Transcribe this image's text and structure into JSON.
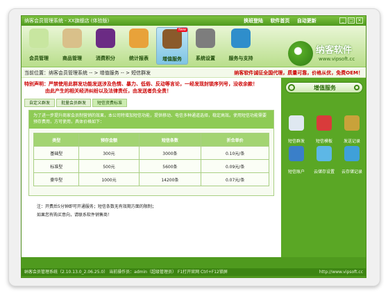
{
  "window": {
    "title": "纳客会员管理系统 - XX旗舰店 (体验版)",
    "links": [
      "换班登陆",
      "软件首页",
      "自动更新"
    ],
    "controls": [
      "_",
      "□",
      "✕"
    ]
  },
  "toolbar": {
    "items": [
      {
        "label": "会员管理",
        "color": "#c8e6a0"
      },
      {
        "label": "商品管理",
        "color": "#d9c08a"
      },
      {
        "label": "消费积分",
        "color": "#6b2b84"
      },
      {
        "label": "统计报表",
        "color": "#e8a23a"
      },
      {
        "label": "增值服务",
        "color": "#8a5a2b",
        "badge": "New"
      },
      {
        "label": "系统设置",
        "color": "#7d7d7d"
      },
      {
        "label": "服务与支持",
        "color": "#2f8ecb"
      }
    ]
  },
  "logo": {
    "name": "纳客软件",
    "url": "www.vipsoft.cc"
  },
  "location": {
    "text": "当前位置：纳客会员管理系统 -- > 增值服务 -- > 短信群发",
    "notice": "纳客软件诚征全国代理，质量可靠，价格从优，免费OEM！"
  },
  "notice": {
    "line1": "特别声明：严禁使用此群发功能发送涉及色情、暴力、低俗、反动等言论，一经发现封锁序列号，没收余款！",
    "line2": "由此产生的相关经济纠纷以及法律责任，由发送者负全责！"
  },
  "subtabs": [
    "自定义群发",
    "批量会员群发",
    "短信资费标准"
  ],
  "intro": "为了进一步提升商家会员制营销的效果，本公司特增加短信功能，提供移动、电信多种通道选择，稳定高效。使用短信功能需要预存费用，方可使用，具体价格如下：",
  "table": {
    "headers": [
      "类型",
      "预存金额",
      "短信条数",
      "折合单价"
    ],
    "rows": [
      [
        "基础型",
        "300元",
        "3000条",
        "0.10元/条"
      ],
      [
        "标准型",
        "500元",
        "5600条",
        "0.09元/条"
      ],
      [
        "豪华型",
        "1000元",
        "14200条",
        "0.07元/条"
      ]
    ]
  },
  "footnote": [
    "注：开费后5分钟即可开通服务；短信条数无有效期方面的限制；",
    "如果您有购买意向，请联系软件销售商！"
  ],
  "side": {
    "title": "增值服务",
    "items": [
      {
        "label": "短信群发",
        "color": "#dfe8f1"
      },
      {
        "label": "短信模板",
        "color": "#d93b3b"
      },
      {
        "label": "发送记录",
        "color": "#c9a23a"
      },
      {
        "label": "短信账户",
        "color": "#3a7fc9"
      },
      {
        "label": "云储存设置",
        "color": "#5db7e6"
      },
      {
        "label": "云存储记录",
        "color": "#3fa0d9"
      }
    ]
  },
  "status": {
    "left": "纳客会员管理系统（2.10.13.0_2.06.25.0）  当前操作员：admin（超级管理员）  F1打开官网 Ctrl+F12锁屏",
    "right": "http://www.vipsoft.cc"
  }
}
